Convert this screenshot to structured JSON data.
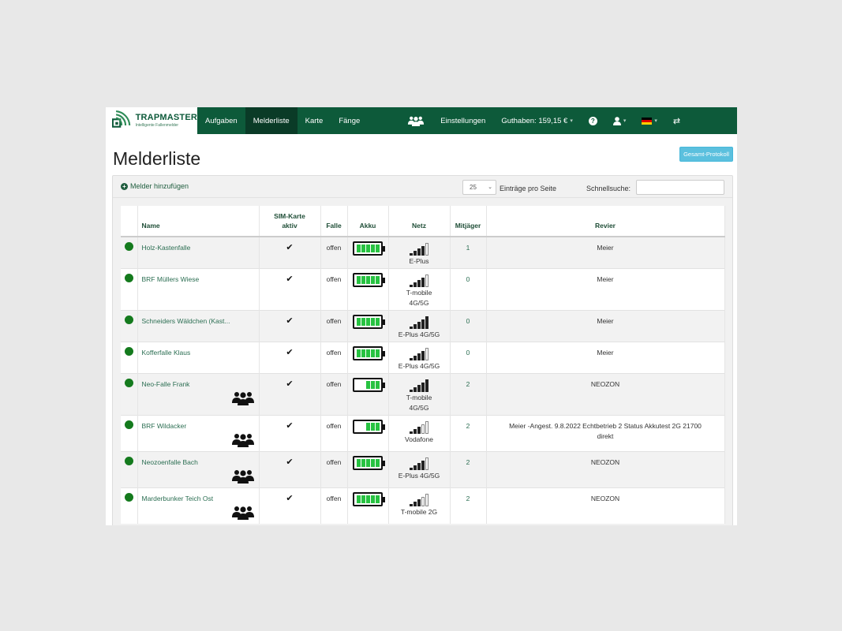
{
  "brand": {
    "title": "TRAPMASTER",
    "subtitle": "Intelligente Fallenmelder"
  },
  "nav": {
    "items": [
      "Aufgaben",
      "Melderliste",
      "Karte",
      "Fänge"
    ],
    "active": "Melderliste",
    "settings": "Einstellungen",
    "balance": "Guthaben: 159,15 €",
    "icons": [
      "group-icon",
      "help-icon",
      "user-icon",
      "flag-de-icon",
      "switch-icon"
    ]
  },
  "page": {
    "title": "Melderliste",
    "protocol_button": "Gesamt-Protokoll"
  },
  "toolbar": {
    "add_label": "Melder hinzufügen",
    "page_size": "25",
    "per_page_label": "Einträge pro Seite",
    "search_label": "Schnellsuche:",
    "search_value": ""
  },
  "table": {
    "headers": {
      "name": "Name",
      "sim_1": "SIM-Karte",
      "sim_2": "aktiv",
      "falle": "Falle",
      "akku": "Akku",
      "netz": "Netz",
      "mitjaeger": "Mitjäger",
      "revier": "Revier"
    },
    "rows": [
      {
        "name": "Holz-Kastenfalle",
        "group": false,
        "sim": "✔",
        "falle": "offen",
        "akku_level": 5,
        "signal_level": 4,
        "netz_1": "E-Plus",
        "netz_2": "",
        "netz_3": "",
        "mitjaeger": "1",
        "revier": "Meier",
        "revier_2": ""
      },
      {
        "name": "BRF Müllers Wiese",
        "group": false,
        "sim": "✔",
        "falle": "offen",
        "akku_level": 5,
        "signal_level": 4,
        "netz_1": "T-mobile",
        "netz_2": "4G/5G",
        "netz_3": "",
        "mitjaeger": "0",
        "revier": "Meier",
        "revier_2": ""
      },
      {
        "name": "Schneiders Wäldchen (Kast...",
        "group": false,
        "sim": "✔",
        "falle": "offen",
        "akku_level": 5,
        "signal_level": 5,
        "netz_1": "E-Plus 4G/5G",
        "netz_2": "",
        "netz_3": "",
        "mitjaeger": "0",
        "revier": "Meier",
        "revier_2": ""
      },
      {
        "name": "Kofferfalle Klaus",
        "group": false,
        "sim": "✔",
        "falle": "offen",
        "akku_level": 5,
        "signal_level": 4,
        "netz_1": "E-Plus 4G/5G",
        "netz_2": "",
        "netz_3": "",
        "mitjaeger": "0",
        "revier": "Meier",
        "revier_2": ""
      },
      {
        "name": "Neo-Falle Frank",
        "group": true,
        "sim": "✔",
        "falle": "offen",
        "akku_level": 3,
        "signal_level": 5,
        "netz_1": "T-mobile",
        "netz_2": "4G/5G",
        "netz_3": "",
        "mitjaeger": "2",
        "revier": "NEOZON",
        "revier_2": ""
      },
      {
        "name": "BRF Wildacker",
        "group": true,
        "sim": "✔",
        "falle": "offen",
        "akku_level": 3,
        "signal_level": 3,
        "netz_1": "Vodafone",
        "netz_2": "",
        "netz_3": "",
        "mitjaeger": "2",
        "revier": "Meier -Angest. 9.8.2022 Echtbetrieb 2 Status Akkutest 2G 21700",
        "revier_2": "direkt"
      },
      {
        "name": "Neozoenfalle Bach",
        "group": true,
        "sim": "✔",
        "falle": "offen",
        "akku_level": 5,
        "signal_level": 4,
        "netz_1": "E-Plus 4G/5G",
        "netz_2": "",
        "netz_3": "",
        "mitjaeger": "2",
        "revier": "NEOZON",
        "revier_2": ""
      },
      {
        "name": "Marderbunker Teich Ost",
        "group": true,
        "sim": "✔",
        "falle": "offen",
        "akku_level": 5,
        "signal_level": 3,
        "netz_1": "T-mobile 2G",
        "netz_2": "",
        "netz_3": "",
        "mitjaeger": "2",
        "revier": "NEOZON",
        "revier_2": ""
      }
    ]
  }
}
